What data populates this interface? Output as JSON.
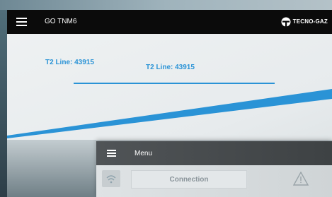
{
  "header": {
    "title": "GO TNM6",
    "brand": "TECNO-GAZ"
  },
  "content": {
    "t2_line_a": "T2 Line: 43915",
    "t2_line_b": "T2 Line: 43915"
  },
  "menu": {
    "title": "Menu",
    "items": [
      {
        "label": "Connection",
        "icon": "wifi-icon"
      }
    ]
  },
  "colors": {
    "accent": "#2a93d6",
    "topbar": "#0b0b0b"
  }
}
